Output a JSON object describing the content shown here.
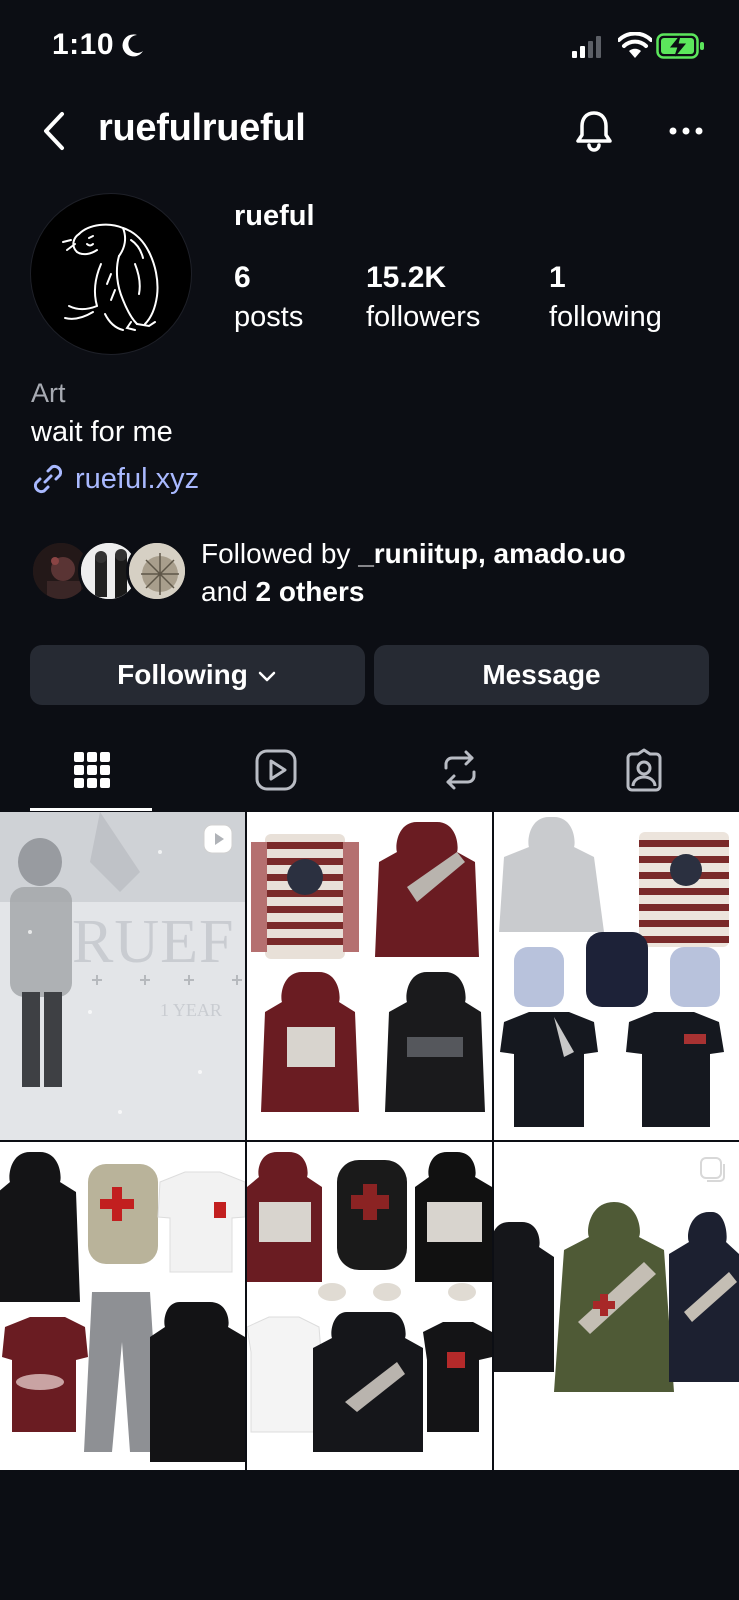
{
  "status_bar": {
    "time": "1:10"
  },
  "header": {
    "username": "ruefulrueful"
  },
  "profile": {
    "display_name": "rueful",
    "posts_count": "6",
    "posts_label": "posts",
    "followers_count": "15.2K",
    "followers_label": "followers",
    "following_count": "1",
    "following_label": "following",
    "category": "Art",
    "bio": "wait for me",
    "link": "rueful.xyz"
  },
  "mutuals": {
    "prefix": "Followed by ",
    "names": "_runiitup, amado.uo",
    "middle": "and ",
    "others": "2 others"
  },
  "actions": {
    "following_label": "Following",
    "message_label": "Message"
  },
  "grid_post_1": {
    "title_text": "RUEF",
    "subtitle_text": "1 YEAR"
  },
  "colors": {
    "background": "#0c0e14",
    "button": "#262a33",
    "link": "#a9b9ff",
    "battery": "#5ce65c"
  }
}
